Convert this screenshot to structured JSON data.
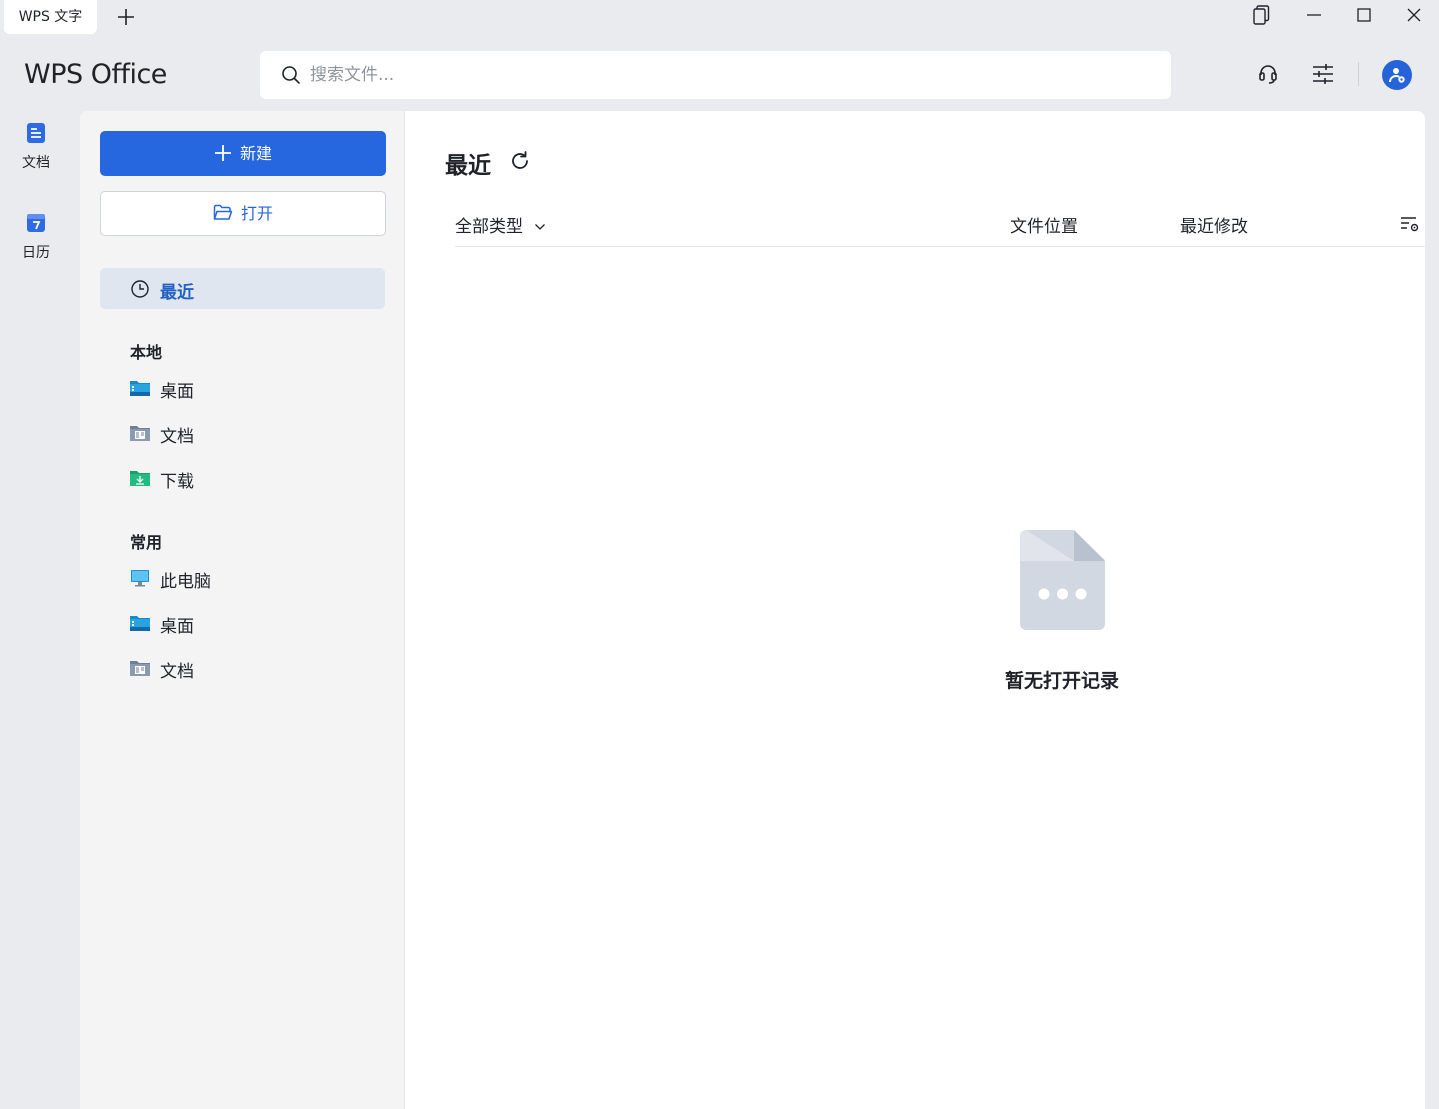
{
  "window": {
    "tab_label": "WPS 文字"
  },
  "header": {
    "logo": "WPS Office",
    "search_placeholder": "搜索文件..."
  },
  "rail": {
    "items": [
      {
        "label": "文档",
        "icon": "document-icon"
      },
      {
        "label": "日历",
        "icon": "calendar-icon"
      }
    ]
  },
  "sidebar": {
    "new_label": "新建",
    "open_label": "打开",
    "recent_label": "最近",
    "local": {
      "title": "本地",
      "items": [
        {
          "label": "桌面",
          "icon": "desktop-folder-icon"
        },
        {
          "label": "文档",
          "icon": "documents-folder-icon"
        },
        {
          "label": "下载",
          "icon": "downloads-folder-icon"
        }
      ]
    },
    "common": {
      "title": "常用",
      "items": [
        {
          "label": "此电脑",
          "icon": "this-pc-icon"
        },
        {
          "label": "桌面",
          "icon": "desktop-folder-icon"
        },
        {
          "label": "文档",
          "icon": "documents-folder-icon"
        }
      ]
    }
  },
  "content": {
    "title": "最近",
    "columns": {
      "type_filter": "全部类型",
      "location": "文件位置",
      "modified": "最近修改"
    },
    "empty_text": "暂无打开记录"
  },
  "colors": {
    "accent": "#2666de",
    "background": "#e9ebef",
    "sidebar": "#f4f4f5",
    "selected": "#e0e6f0"
  }
}
